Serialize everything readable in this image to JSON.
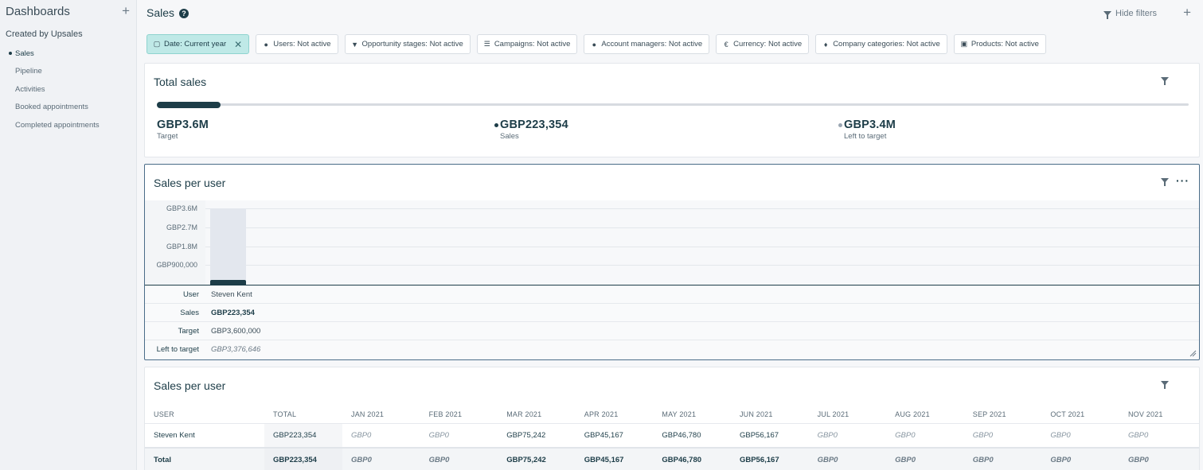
{
  "sidebar": {
    "title": "Dashboards",
    "group": "Created by Upsales",
    "items": [
      {
        "label": "Sales"
      },
      {
        "label": "Pipeline"
      },
      {
        "label": "Activities"
      },
      {
        "label": "Booked appointments"
      },
      {
        "label": "Completed appointments"
      }
    ]
  },
  "header": {
    "title": "Sales",
    "hide_filters": "Hide filters"
  },
  "filters": [
    {
      "label": "Date: Current year",
      "icon": "calendar-icon",
      "active": true
    },
    {
      "label": "Users: Not active",
      "icon": "user-icon"
    },
    {
      "label": "Opportunity stages: Not active",
      "icon": "funnel-icon"
    },
    {
      "label": "Campaigns: Not active",
      "icon": "list-icon"
    },
    {
      "label": "Account managers: Not active",
      "icon": "user-icon"
    },
    {
      "label": "Currency: Not active",
      "icon": "euro-icon"
    },
    {
      "label": "Company categories: Not active",
      "icon": "tag-icon"
    },
    {
      "label": "Products: Not active",
      "icon": "cube-icon"
    }
  ],
  "total_sales": {
    "title": "Total sales",
    "progress": 0.062,
    "target": {
      "value": "GBP3.6M",
      "label": "Target"
    },
    "sales": {
      "value": "GBP223,354",
      "label": "Sales"
    },
    "left": {
      "value": "GBP3.4M",
      "label": "Left to target"
    },
    "colors": {
      "sales": "#1d3d48",
      "left": "#9aa6b2"
    }
  },
  "sales_per_user_chart": {
    "title": "Sales per user",
    "yticks": [
      "GBP3.6M",
      "GBP2.7M",
      "GBP1.8M",
      "GBP900,000"
    ],
    "rows": {
      "user": {
        "label": "User",
        "value": "Steven Kent"
      },
      "sales": {
        "label": "Sales",
        "value": "GBP223,354"
      },
      "target": {
        "label": "Target",
        "value": "GBP3,600,000"
      },
      "left": {
        "label": "Left to target",
        "value": "GBP3,376,646"
      }
    }
  },
  "chart_data": {
    "type": "bar",
    "categories": [
      "Steven Kent"
    ],
    "series": [
      {
        "name": "Target",
        "values": [
          3600000
        ]
      },
      {
        "name": "Sales",
        "values": [
          223354
        ]
      }
    ],
    "ylim": [
      0,
      3600000
    ],
    "yticks": [
      "GBP900,000",
      "GBP1.8M",
      "GBP2.7M",
      "GBP3.6M"
    ],
    "title": "Sales per user"
  },
  "sales_per_user_table": {
    "title": "Sales per user",
    "headers": [
      "USER",
      "TOTAL",
      "JAN 2021",
      "FEB 2021",
      "MAR 2021",
      "APR 2021",
      "MAY 2021",
      "JUN 2021",
      "JUL 2021",
      "AUG 2021",
      "SEP 2021",
      "OCT 2021",
      "NOV 2021"
    ],
    "rows": [
      {
        "user": "Steven Kent",
        "total": "GBP223,354",
        "months": [
          "GBP0",
          "GBP0",
          "GBP75,242",
          "GBP45,167",
          "GBP46,780",
          "GBP56,167",
          "GBP0",
          "GBP0",
          "GBP0",
          "GBP0",
          "GBP0"
        ]
      }
    ],
    "total_row": {
      "user": "Total",
      "total": "GBP223,354",
      "months": [
        "GBP0",
        "GBP0",
        "GBP75,242",
        "GBP45,167",
        "GBP46,780",
        "GBP56,167",
        "GBP0",
        "GBP0",
        "GBP0",
        "GBP0",
        "GBP0"
      ]
    }
  }
}
